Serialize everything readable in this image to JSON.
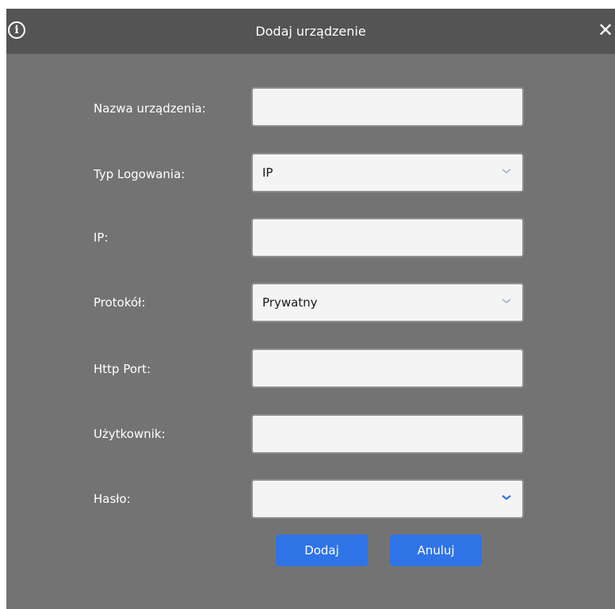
{
  "dialog": {
    "title": "Dodaj urządzenie",
    "info_icon": "info-icon",
    "close_icon": "close-icon",
    "close_glyph": "✕"
  },
  "form": {
    "device_name": {
      "label": "Nazwa urządzenia:",
      "value": ""
    },
    "login_type": {
      "label": "Typ Logowania:",
      "value": "IP"
    },
    "ip": {
      "label": "IP:",
      "value": ""
    },
    "protocol": {
      "label": "Protokół:",
      "value": "Prywatny"
    },
    "http_port": {
      "label": "Http Port:",
      "value": ""
    },
    "user": {
      "label": "Użytkownik:",
      "value": ""
    },
    "password": {
      "label": "Hasło:",
      "value": ""
    }
  },
  "buttons": {
    "add_label": "Dodaj",
    "cancel_label": "Anuluj"
  },
  "colors": {
    "dialog_bg": "#737373",
    "titlebar_bg": "#545454",
    "button_bg": "#2f74e6",
    "chevron_default": "#a9b7cc",
    "chevron_active": "#2f74e6"
  }
}
